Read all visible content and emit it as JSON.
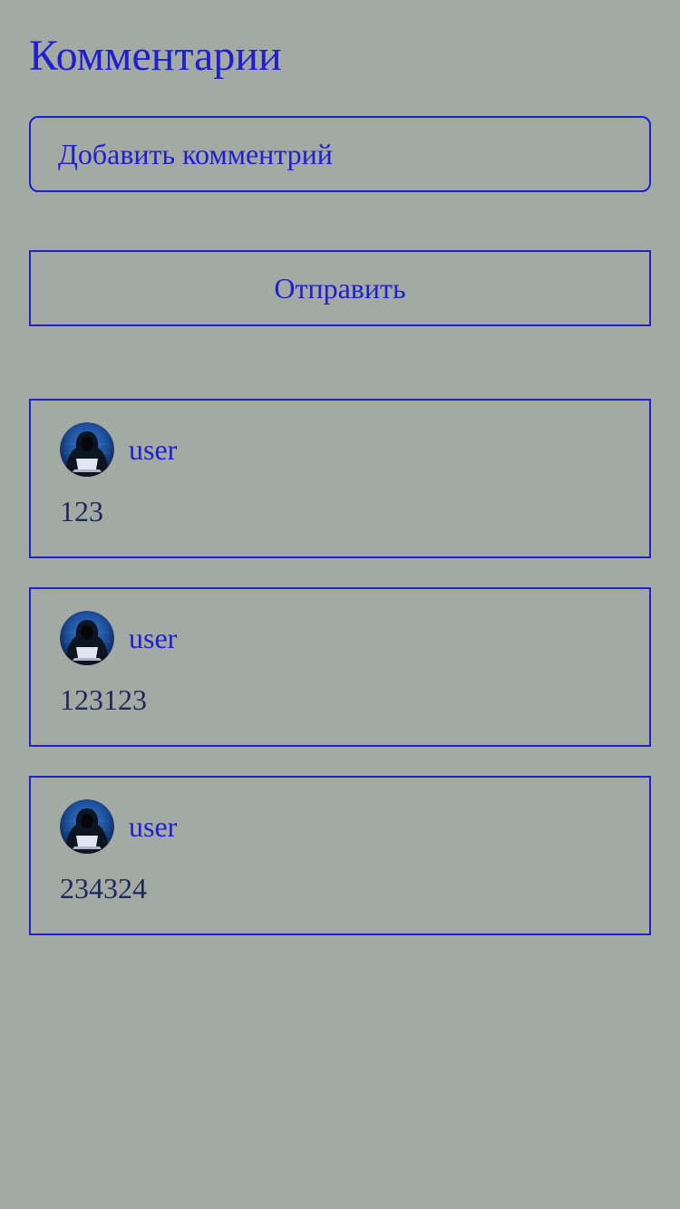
{
  "page": {
    "title": "Комментарии"
  },
  "form": {
    "input_placeholder": "Добавить комментрий",
    "input_value": "",
    "submit_label": "Отправить"
  },
  "comments": [
    {
      "username": "user",
      "text": "123",
      "avatar_icon": "hooded-hacker-avatar-icon"
    },
    {
      "username": "user",
      "text": "123123",
      "avatar_icon": "hooded-hacker-avatar-icon"
    },
    {
      "username": "user",
      "text": "234324",
      "avatar_icon": "hooded-hacker-avatar-icon"
    }
  ],
  "colors": {
    "background": "#a3aaa4",
    "accent": "#1f1fd0",
    "comment_text": "#1b2a5a"
  }
}
